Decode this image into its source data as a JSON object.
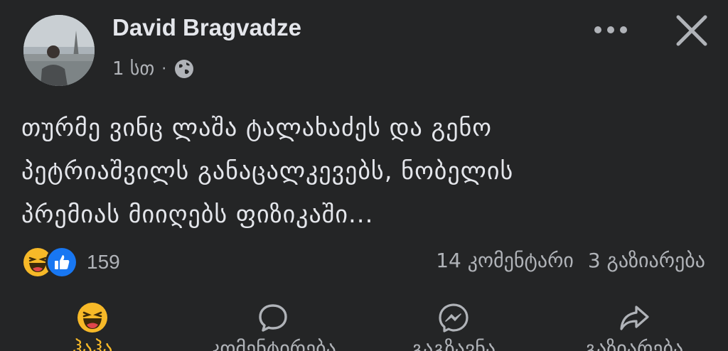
{
  "post": {
    "author": "David Bragvadze",
    "time": "1 სთ",
    "separator": "·",
    "text_lines": [
      "თურმე ვინც ლაშა ტალახაძეს და გენო",
      "პეტრიაშვილს განაცალკევებს, ნობელის",
      "პრემიას მიიღებს ფიზიკაში..."
    ]
  },
  "icons": {
    "more": "more-horizontal-icon",
    "close": "close-icon",
    "privacy": "globe-icon"
  },
  "stats": {
    "reaction_count": "159",
    "comments": "14 კომენტარი",
    "shares": "3 გაზიარება"
  },
  "actions": [
    {
      "label": "ჰაჰა",
      "icon": "haha-icon",
      "active": true,
      "accent": "#f7b928"
    },
    {
      "label": "კომენტირება",
      "icon": "comment-icon",
      "active": false
    },
    {
      "label": "გაგზავნა",
      "icon": "messenger-icon",
      "active": false
    },
    {
      "label": "გაზიარება",
      "icon": "share-icon",
      "active": false
    }
  ],
  "colors": {
    "background": "#242526",
    "text": "#e4e6eb",
    "secondary_text": "#b0b3b8",
    "like_blue": "#1877f2",
    "haha_yellow": "#f7b928"
  }
}
